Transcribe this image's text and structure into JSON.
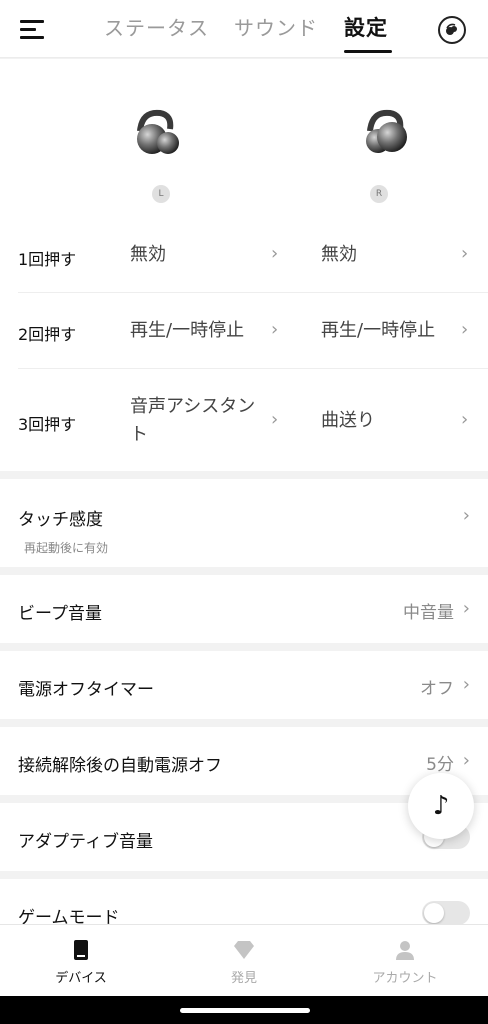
{
  "header": {
    "tabs": [
      {
        "label": "ステータス",
        "active": false
      },
      {
        "label": "サウンド",
        "active": false
      },
      {
        "label": "設定",
        "active": true
      }
    ]
  },
  "earbuds": {
    "left_label": "L",
    "right_label": "R"
  },
  "tap_settings": [
    {
      "label": "1回押す",
      "left": "無効",
      "right": "無効"
    },
    {
      "label": "2回押す",
      "left": "再生/一時停止",
      "right": "再生/一時停止"
    },
    {
      "label": "3回押す",
      "left": "音声アシスタント",
      "right": "曲送り"
    }
  ],
  "settings": {
    "touch_sensitivity": {
      "title": "タッチ感度",
      "subtitle": "再起動後に有効"
    },
    "beep_volume": {
      "title": "ビープ音量",
      "value": "中音量"
    },
    "power_off_timer": {
      "title": "電源オフタイマー",
      "value": "オフ"
    },
    "auto_power_off": {
      "title": "接続解除後の自動電源オフ",
      "value": "5分"
    },
    "adaptive_volume": {
      "title": "アダプティブ音量",
      "enabled": false
    },
    "game_mode": {
      "title": "ゲームモード",
      "enabled": false
    }
  },
  "bottom_nav": [
    {
      "label": "デバイス",
      "active": true
    },
    {
      "label": "発見",
      "active": false
    },
    {
      "label": "アカウント",
      "active": false
    }
  ],
  "icons": {
    "menu": "menu-icon",
    "device": "earbud-icon",
    "music": "music-note-icon",
    "chevron": "chevron-right-icon"
  },
  "colors": {
    "accent": "#111111",
    "inactive": "#9a9a9a",
    "background": "#f2f2f2"
  }
}
